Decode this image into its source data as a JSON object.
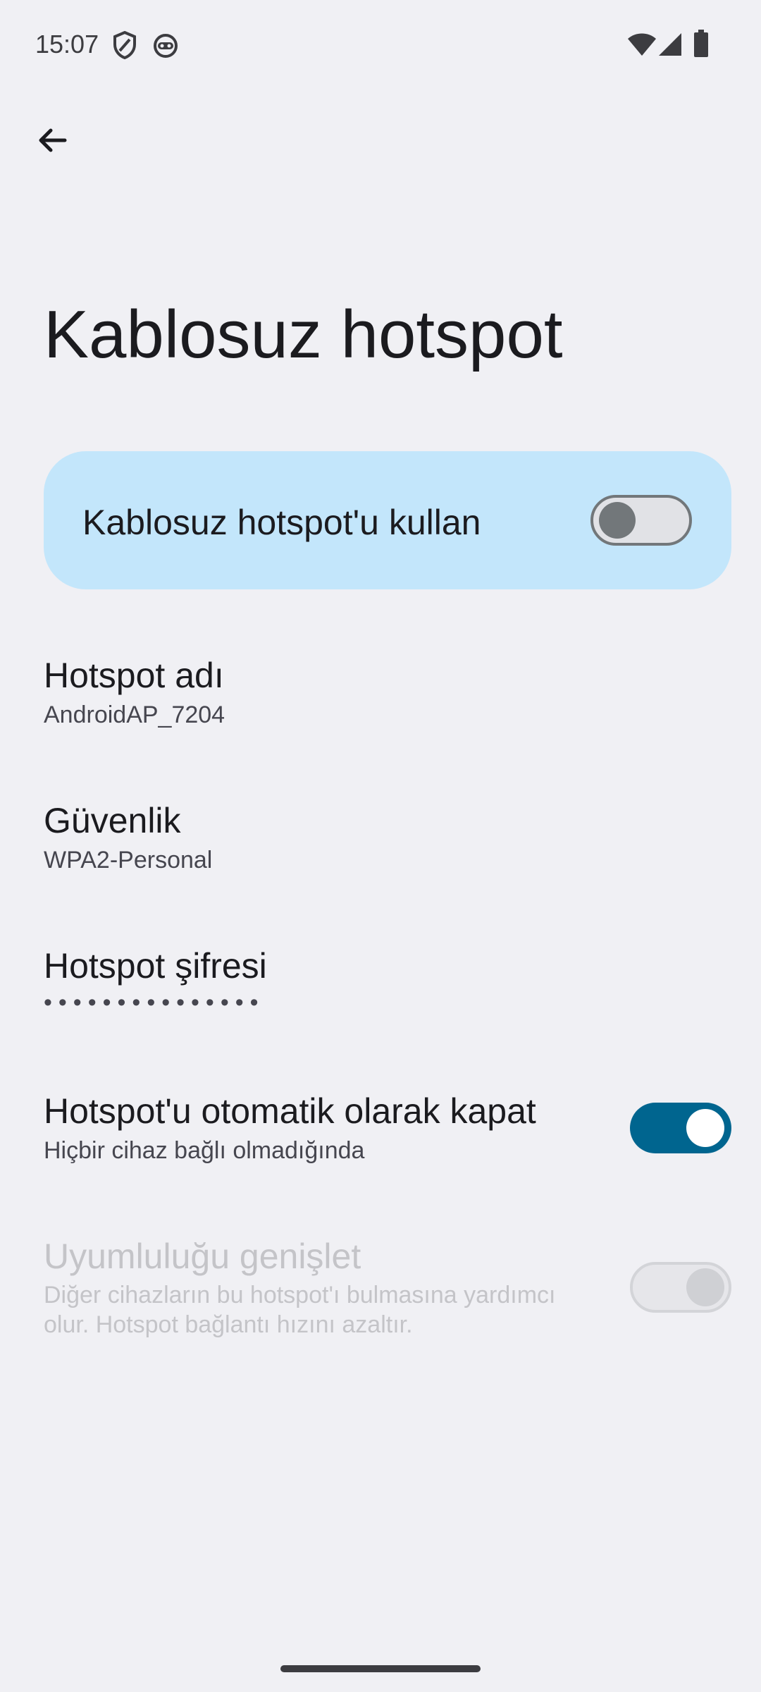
{
  "status_bar": {
    "time": "15:07",
    "icons_left": [
      "shield-icon",
      "android-face-icon"
    ],
    "icons_right": [
      "wifi-icon",
      "cellular-signal-icon",
      "battery-icon"
    ]
  },
  "header": {
    "back_icon": "arrow-back-icon",
    "title": "Kablosuz hotspot"
  },
  "main_toggle": {
    "label": "Kablosuz hotspot'u kullan",
    "checked": false
  },
  "settings": {
    "hotspot_name": {
      "title": "Hotspot adı",
      "summary": "AndroidAP_7204"
    },
    "security": {
      "title": "Güvenlik",
      "summary": "WPA2-Personal"
    },
    "password": {
      "title": "Hotspot şifresi",
      "masked": "•••••••••••••••"
    },
    "auto_off": {
      "title": "Hotspot'u otomatik olarak kapat",
      "summary": "Hiçbir cihaz bağlı olmadığında",
      "checked": true
    },
    "extend_compat": {
      "title": "Uyumluluğu genişlet",
      "summary": "Diğer cihazların bu hotspot'ı bulmasına yardımcı olur. Hotspot bağlantı hızını azaltır.",
      "checked": true,
      "enabled": false
    }
  },
  "colors": {
    "background": "#f0f0f4",
    "card": "#c3e6fb",
    "accent": "#00658f",
    "disabled_text": "#c4c4c8"
  }
}
